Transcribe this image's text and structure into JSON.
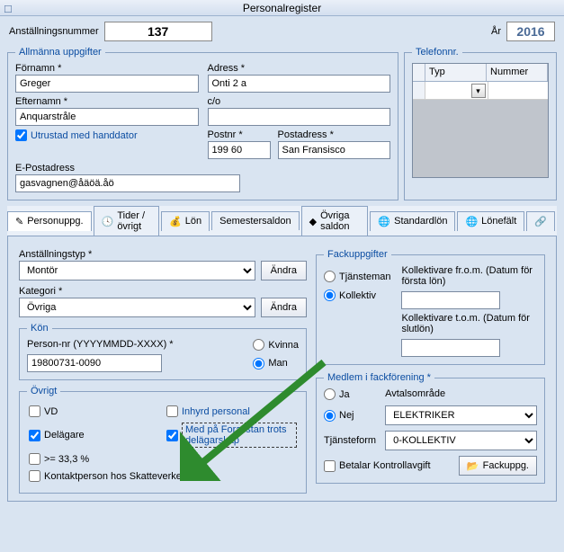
{
  "window": {
    "title": "Personalregister"
  },
  "top": {
    "emp_no_label": "Anställningsnummer",
    "emp_no": "137",
    "year_label": "År",
    "year": "2016"
  },
  "general": {
    "legend": "Allmänna uppgifter",
    "fornamn_label": "Förnamn *",
    "fornamn": "Greger",
    "efternamn_label": "Efternamn *",
    "efternamn": "Anquarstråle",
    "handdator_label": "Utrustad med handdator",
    "epost_label": "E-Postadress",
    "epost": "gasvagnen@åäöä.åö",
    "adress_label": "Adress *",
    "adress": "Onti 2 a",
    "co_label": "c/o",
    "co": "",
    "postnr_label": "Postnr *",
    "postnr": "199 60",
    "postadress_label": "Postadress *",
    "postadress": "San Fransisco"
  },
  "telefon": {
    "legend": "Telefonnr.",
    "col_typ": "Typ",
    "col_nummer": "Nummer"
  },
  "tabs": {
    "personuppg": "Personuppg.",
    "tider": "Tider / övrigt",
    "lon": "Lön",
    "semester": "Semestersaldon",
    "ovriga": "Övriga saldon",
    "standardlon": "Standardlön",
    "lonefalt": "Lönefält"
  },
  "left": {
    "anst_typ_label": "Anställningstyp *",
    "anst_typ": "Montör",
    "kategori_label": "Kategori *",
    "kategori": "Övriga",
    "andra_btn": "Ändra",
    "kon_legend": "Kön",
    "person_nr_label": "Person-nr (YYYYMMDD-XXXX) *",
    "person_nr": "19800731-0090",
    "kvinna": "Kvinna",
    "man": "Man",
    "ovrigt_legend": "Övrigt",
    "vd": "VD",
    "inhyrd": "Inhyrd personal",
    "delagare": "Delägare",
    "foralistan": "Med på Foralistan trots delägarskap",
    "ge33": ">= 33,3 %",
    "kontaktperson": "Kontaktperson hos Skatteverket"
  },
  "right": {
    "fack_legend": "Fackuppgifter",
    "tjansteman": "Tjänsteman",
    "kollektiv": "Kollektiv",
    "k_from_label": "Kollektivare fr.o.m. (Datum för första lön)",
    "k_from": "",
    "k_tom_label": "Kollektivare t.o.m. (Datum för slutlön)",
    "k_tom": "",
    "medlem_legend": "Medlem i fackförening *",
    "ja": "Ja",
    "nej": "Nej",
    "avtal_label": "Avtalsområde",
    "avtal": "ELEKTRIKER",
    "tjform_label": "Tjänsteform",
    "tjform": "0-KOLLEKTIV",
    "betalar": "Betalar Kontrollavgift",
    "fackuppg_btn": "Fackuppg."
  }
}
